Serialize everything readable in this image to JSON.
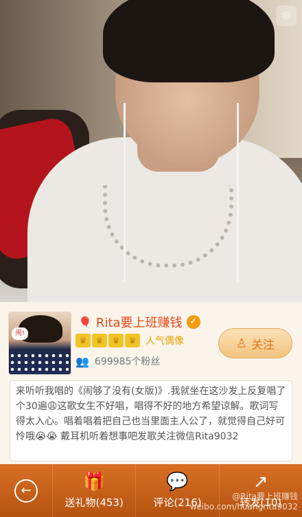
{
  "video": {
    "corner_button": "◎"
  },
  "profile": {
    "name": "Rita要上班赚钱",
    "avatar_badge": "闹!",
    "title": "人气偶像",
    "fans": "699985个粉丝",
    "follow_label": "关注",
    "description": "来听听我唱的《闹够了没有(女版)》.我就坐在这沙发上反复唱了个30遍😩这歌女生不好唱，唱得不好的地方希望谅解。歌词写得太入心。唱着唱着把自己也当里面主人公了，就觉得自己好可怜哦😭😭 戴耳机听着想事吧发歌关注微信Rita9032"
  },
  "bottom_bar": {
    "gift": "送礼物(453)",
    "comment": "评论(216)",
    "forward": "转发(10)"
  },
  "watermark": {
    "line1": "@Rita要上班赚钱",
    "line2": "weibo.com/huangrita9032"
  },
  "colors": {
    "accent": "#d86f25",
    "name": "#e34b1c",
    "title": "#e8a000"
  }
}
